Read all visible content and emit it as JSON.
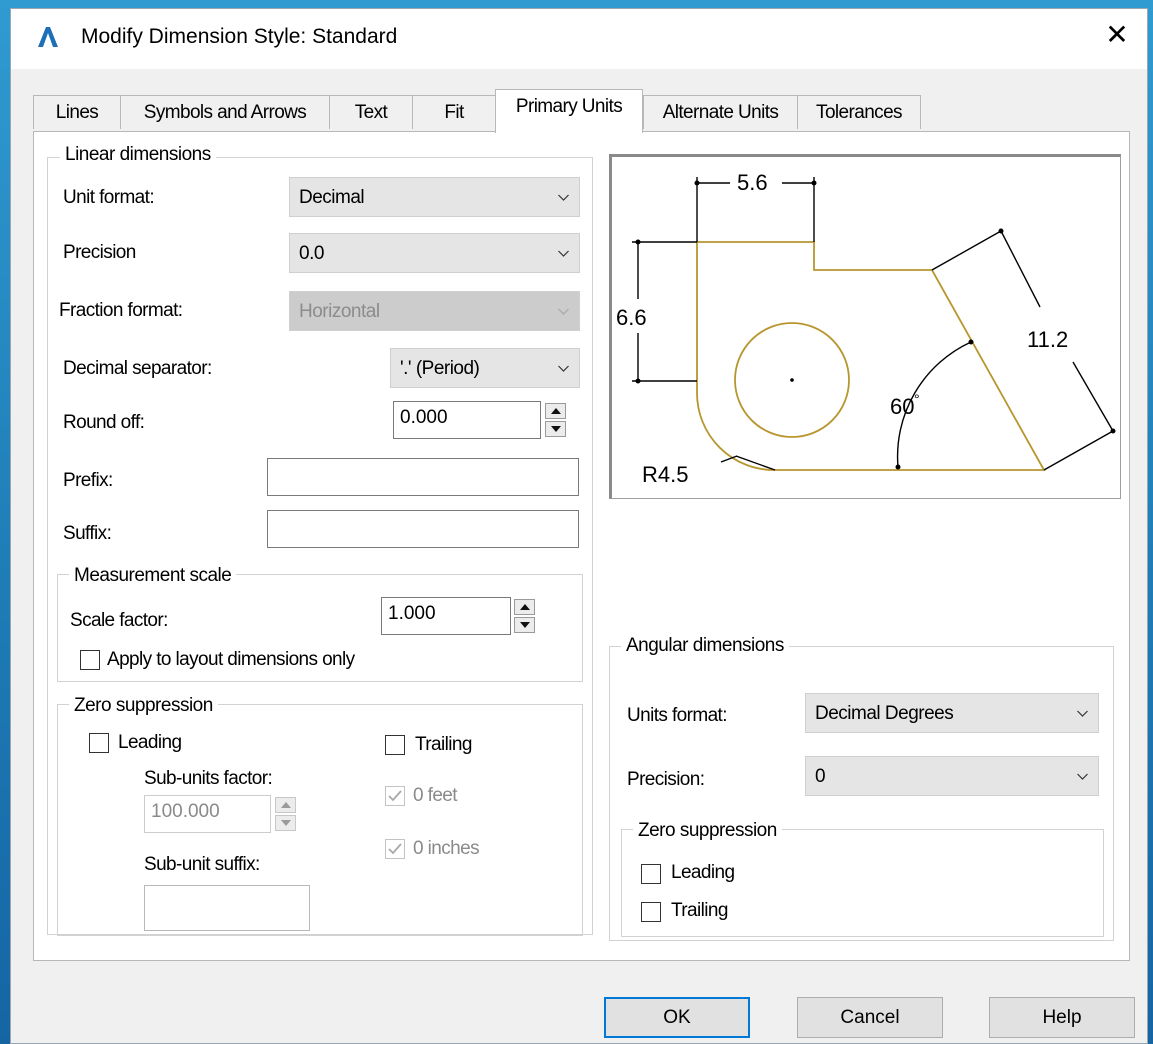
{
  "window": {
    "title": "Modify Dimension Style: Standard",
    "app_icon": "autocad-icon",
    "close_symbol": "✕"
  },
  "tabs": [
    {
      "label": "Lines",
      "active": false
    },
    {
      "label": "Symbols and Arrows",
      "active": false
    },
    {
      "label": "Text",
      "active": false
    },
    {
      "label": "Fit",
      "active": false
    },
    {
      "label": "Primary Units",
      "active": true
    },
    {
      "label": "Alternate Units",
      "active": false
    },
    {
      "label": "Tolerances",
      "active": false
    }
  ],
  "linear": {
    "title": "Linear dimensions",
    "unit_format_label": "Unit format:",
    "unit_format_value": "Decimal",
    "precision_label": "Precision",
    "precision_value": "0.0",
    "fraction_format_label": "Fraction format:",
    "fraction_format_value": "Horizontal",
    "decimal_separator_label": "Decimal separator:",
    "decimal_separator_value": "'.' (Period)",
    "round_off_label": "Round off:",
    "round_off_value": "0.000",
    "prefix_label": "Prefix:",
    "prefix_value": "",
    "suffix_label": "Suffix:",
    "suffix_value": ""
  },
  "measurement_scale": {
    "title": "Measurement scale",
    "scale_factor_label": "Scale factor:",
    "scale_factor_value": "1.000",
    "apply_layout_label": "Apply to layout dimensions only",
    "apply_layout_checked": false
  },
  "zero_suppression_linear": {
    "title": "Zero suppression",
    "leading_label": "Leading",
    "leading_checked": false,
    "trailing_label": "Trailing",
    "trailing_checked": false,
    "sub_units_factor_label": "Sub-units factor:",
    "sub_units_factor_value": "100.000",
    "sub_unit_suffix_label": "Sub-unit suffix:",
    "sub_unit_suffix_value": "",
    "feet_label": "0 feet",
    "feet_checked": true,
    "inches_label": "0 inches",
    "inches_checked": true
  },
  "preview": {
    "dim_top": "5.6",
    "dim_left": "6.6",
    "dim_right": "11.2",
    "dim_angle": "60",
    "dim_radius": "R4.5",
    "colors": {
      "geometry": "#b8962e",
      "dimension": "#000000"
    }
  },
  "angular": {
    "title": "Angular dimensions",
    "units_format_label": "Units format:",
    "units_format_value": "Decimal Degrees",
    "precision_label": "Precision:",
    "precision_value": "0",
    "zero_title": "Zero suppression",
    "leading_label": "Leading",
    "leading_checked": false,
    "trailing_label": "Trailing",
    "trailing_checked": false
  },
  "buttons": {
    "ok": "OK",
    "cancel": "Cancel",
    "help": "Help"
  },
  "colors": {
    "accent": "#0078d7",
    "background": "#2a90c8"
  }
}
